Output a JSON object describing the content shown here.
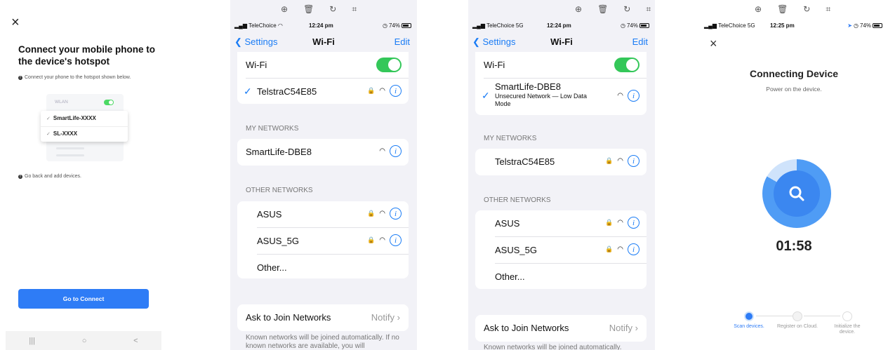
{
  "toolbar_icons": [
    "zoom-in-icon",
    "trash-icon",
    "rotate-icon",
    "crop-icon"
  ],
  "panel1": {
    "close": "×",
    "title": "Connect your mobile phone to the device's hotspot",
    "hint1": "Connect your phone to the hotspot shown below.",
    "wlan_label": "WLAN",
    "networks": [
      "SmartLife-XXXX",
      "SL-XXXX"
    ],
    "hint2": "Go back and add devices.",
    "button": "Go to Connect",
    "nav": [
      "|||",
      "○",
      "<"
    ]
  },
  "panel2": {
    "carrier": "TeleChoice",
    "time": "12:24 pm",
    "battery": "74%",
    "back": "Settings",
    "title": "Wi-Fi",
    "edit": "Edit",
    "wifi_label": "Wi-Fi",
    "connected": "TelstraC54E85",
    "my_networks_label": "MY NETWORKS",
    "my_networks": [
      "SmartLife-DBE8"
    ],
    "other_networks_label": "OTHER NETWORKS",
    "other_networks": [
      "ASUS",
      "ASUS_5G"
    ],
    "other": "Other...",
    "ask_label": "Ask to Join Networks",
    "ask_value": "Notify",
    "footer": "Known networks will be joined automatically. If no known networks are available, you will"
  },
  "panel3": {
    "carrier": "TeleChoice 5G",
    "time": "12:24 pm",
    "battery": "74%",
    "back": "Settings",
    "title": "Wi-Fi",
    "edit": "Edit",
    "wifi_label": "Wi-Fi",
    "connected": "SmartLife-DBE8",
    "connected_sub": "Unsecured Network — Low Data Mode",
    "my_networks_label": "MY NETWORKS",
    "my_networks": [
      "TelstraC54E85"
    ],
    "other_networks_label": "OTHER NETWORKS",
    "other_networks": [
      "ASUS",
      "ASUS_5G"
    ],
    "other": "Other...",
    "ask_label": "Ask to Join Networks",
    "ask_value": "Notify",
    "footer": "Known networks will be joined automatically."
  },
  "panel4": {
    "carrier": "TeleChoice 5G",
    "time": "12:25 pm",
    "battery": "74%",
    "close": "×",
    "title": "Connecting Device",
    "subtitle": "Power on the device.",
    "timer": "01:58",
    "steps": [
      {
        "label": "Scan devices.",
        "active": true
      },
      {
        "label": "Register on Cloud.",
        "active": false
      },
      {
        "label": "Initialize the device.",
        "active": false
      }
    ],
    "accent": "#3b87f0"
  }
}
